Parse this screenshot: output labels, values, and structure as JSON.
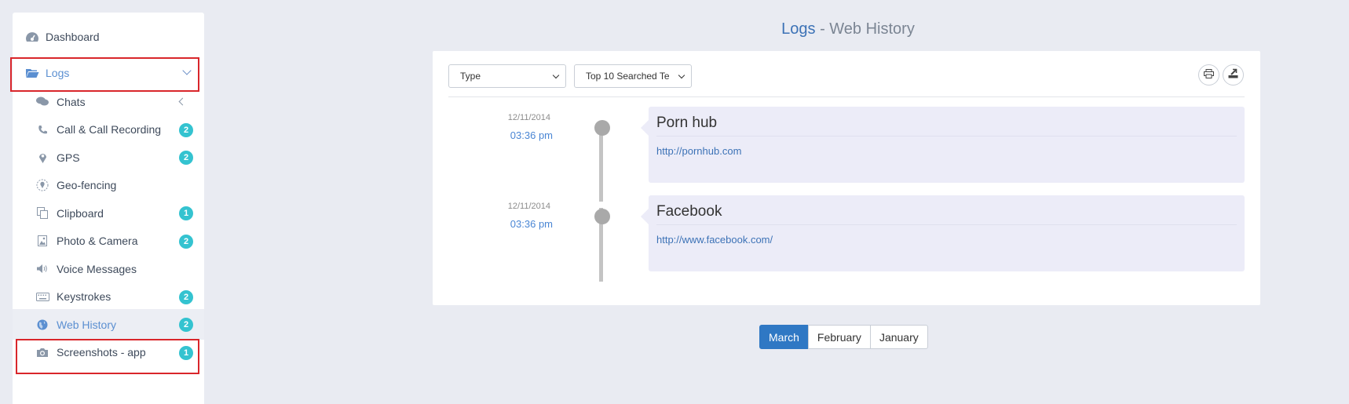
{
  "sidebar": {
    "dashboard": {
      "label": "Dashboard",
      "icon": "dashboard-icon"
    },
    "logs": {
      "label": "Logs",
      "icon": "folder-open-icon"
    },
    "items": [
      {
        "label": "Chats",
        "icon": "chat-icon",
        "badge": null,
        "chevron": true
      },
      {
        "label": "Call & Call Recording",
        "icon": "phone-icon",
        "badge": "2"
      },
      {
        "label": "GPS",
        "icon": "map-pin-icon",
        "badge": "2"
      },
      {
        "label": "Geo-fencing",
        "icon": "geofence-icon",
        "badge": null
      },
      {
        "label": "Clipboard",
        "icon": "clipboard-icon",
        "badge": "1"
      },
      {
        "label": "Photo & Camera",
        "icon": "image-icon",
        "badge": "2"
      },
      {
        "label": "Voice Messages",
        "icon": "speaker-icon",
        "badge": null
      },
      {
        "label": "Keystrokes",
        "icon": "keyboard-icon",
        "badge": "2"
      },
      {
        "label": "Web History",
        "icon": "globe-icon",
        "badge": "2",
        "active": true
      },
      {
        "label": "Screenshots - app",
        "icon": "camera-icon",
        "badge": "1"
      }
    ]
  },
  "header": {
    "title_part1": "Logs",
    "title_part2": " - Web History"
  },
  "filters": {
    "type_select": "Type",
    "top_select": "Top 10 Searched Te"
  },
  "timeline": [
    {
      "date": "12/11/2014",
      "time": "03:36 pm",
      "title": "Porn hub",
      "url": "http://pornhub.com"
    },
    {
      "date": "12/11/2014",
      "time": "03:36 pm",
      "title": "Facebook",
      "url": "http://www.facebook.com/"
    }
  ],
  "pager": {
    "months": [
      "March",
      "February",
      "January"
    ],
    "active": "March"
  },
  "colors": {
    "accent": "#3c72b6",
    "badge": "#34c3d0",
    "highlight_box": "#d9262b",
    "entry_bg": "#ececf8"
  }
}
